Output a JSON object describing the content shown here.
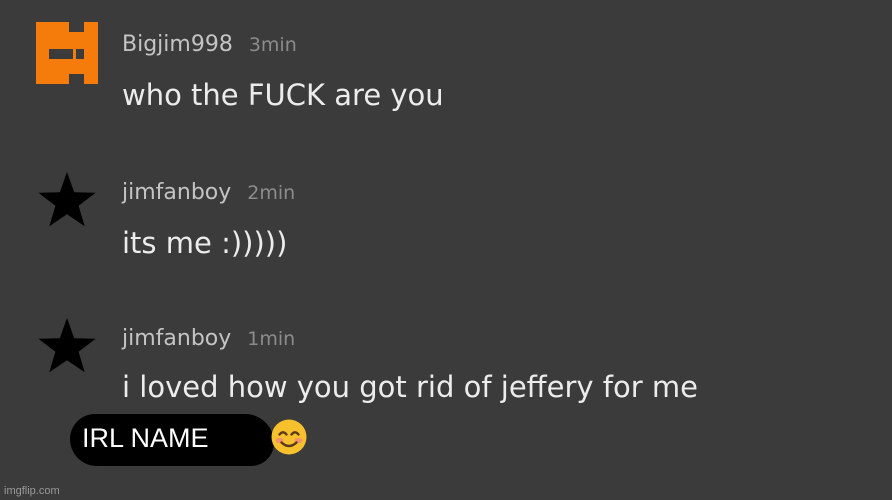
{
  "comments": [
    {
      "avatar_icon": "orange-block-logo-icon",
      "username": "Bigjim998",
      "time": "3min",
      "text": "who the FUCK are you"
    },
    {
      "avatar_icon": "black-star-icon",
      "username": "jimfanboy",
      "time": "2min",
      "text": "its me :)))))"
    },
    {
      "avatar_icon": "black-star-icon",
      "username": "jimfanboy",
      "time": "1min",
      "text": "i loved how you got rid of jeffery for me"
    }
  ],
  "overlay": {
    "redaction_label": "IRL NAME",
    "emoji_icon": "smiling-face-emoji-icon"
  },
  "watermark": "imgflip.com",
  "colors": {
    "background": "#3b3b3b",
    "avatar_orange": "#f57c0a",
    "username": "#c4c4c4",
    "timestamp": "#8c8c8c",
    "comment_text": "#ececec"
  }
}
